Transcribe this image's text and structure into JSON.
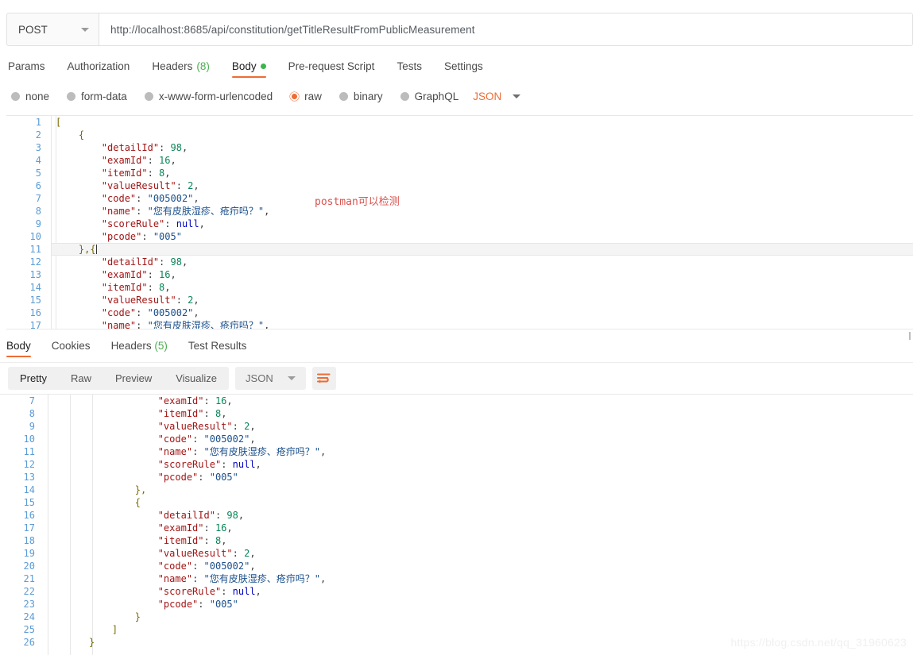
{
  "request": {
    "method": "POST",
    "url": "http://localhost:8685/api/constitution/getTitleResultFromPublicMeasurement",
    "tabs": [
      {
        "label": "Params",
        "count": "",
        "dot": false,
        "active": false
      },
      {
        "label": "Authorization",
        "count": "",
        "dot": false,
        "active": false
      },
      {
        "label": "Headers",
        "count": "(8)",
        "dot": false,
        "active": false
      },
      {
        "label": "Body",
        "count": "",
        "dot": true,
        "active": true
      },
      {
        "label": "Pre-request Script",
        "count": "",
        "dot": false,
        "active": false
      },
      {
        "label": "Tests",
        "count": "",
        "dot": false,
        "active": false
      },
      {
        "label": "Settings",
        "count": "",
        "dot": false,
        "active": false
      }
    ],
    "body_types": [
      {
        "label": "none",
        "selected": false
      },
      {
        "label": "form-data",
        "selected": false
      },
      {
        "label": "x-www-form-urlencoded",
        "selected": false
      },
      {
        "label": "raw",
        "selected": true
      },
      {
        "label": "binary",
        "selected": false
      },
      {
        "label": "GraphQL",
        "selected": false
      }
    ],
    "raw_format": "JSON",
    "body_lines": [
      {
        "n": 1,
        "segments": [
          {
            "t": "[",
            "c": "br"
          }
        ]
      },
      {
        "n": 2,
        "segments": [
          {
            "t": "    {",
            "c": "br"
          }
        ]
      },
      {
        "n": 3,
        "segments": [
          {
            "t": "        ",
            "c": "p"
          },
          {
            "t": "\"detailId\"",
            "c": "k"
          },
          {
            "t": ": ",
            "c": "p"
          },
          {
            "t": "98",
            "c": "n"
          },
          {
            "t": ",",
            "c": "p"
          }
        ]
      },
      {
        "n": 4,
        "segments": [
          {
            "t": "        ",
            "c": "p"
          },
          {
            "t": "\"examId\"",
            "c": "k"
          },
          {
            "t": ": ",
            "c": "p"
          },
          {
            "t": "16",
            "c": "n"
          },
          {
            "t": ",",
            "c": "p"
          }
        ]
      },
      {
        "n": 5,
        "segments": [
          {
            "t": "        ",
            "c": "p"
          },
          {
            "t": "\"itemId\"",
            "c": "k"
          },
          {
            "t": ": ",
            "c": "p"
          },
          {
            "t": "8",
            "c": "n"
          },
          {
            "t": ",",
            "c": "p"
          }
        ]
      },
      {
        "n": 6,
        "segments": [
          {
            "t": "        ",
            "c": "p"
          },
          {
            "t": "\"valueResult\"",
            "c": "k"
          },
          {
            "t": ": ",
            "c": "p"
          },
          {
            "t": "2",
            "c": "n"
          },
          {
            "t": ",",
            "c": "p"
          }
        ]
      },
      {
        "n": 7,
        "segments": [
          {
            "t": "        ",
            "c": "p"
          },
          {
            "t": "\"code\"",
            "c": "k"
          },
          {
            "t": ": ",
            "c": "p"
          },
          {
            "t": "\"005002\"",
            "c": "s"
          },
          {
            "t": ",",
            "c": "p"
          }
        ]
      },
      {
        "n": 8,
        "segments": [
          {
            "t": "        ",
            "c": "p"
          },
          {
            "t": "\"name\"",
            "c": "k"
          },
          {
            "t": ": ",
            "c": "p"
          },
          {
            "t": "\"您有皮肤湿疹、疮疖吗？\"",
            "c": "s"
          },
          {
            "t": ",",
            "c": "p"
          }
        ]
      },
      {
        "n": 9,
        "segments": [
          {
            "t": "        ",
            "c": "p"
          },
          {
            "t": "\"scoreRule\"",
            "c": "k"
          },
          {
            "t": ": ",
            "c": "p"
          },
          {
            "t": "null",
            "c": "nl"
          },
          {
            "t": ",",
            "c": "p"
          }
        ]
      },
      {
        "n": 10,
        "segments": [
          {
            "t": "        ",
            "c": "p"
          },
          {
            "t": "\"pcode\"",
            "c": "k"
          },
          {
            "t": ": ",
            "c": "p"
          },
          {
            "t": "\"005\"",
            "c": "s"
          }
        ]
      },
      {
        "n": 11,
        "segments": [
          {
            "t": "    },{",
            "c": "br"
          }
        ],
        "active": true,
        "cursor": true
      },
      {
        "n": 12,
        "segments": [
          {
            "t": "        ",
            "c": "p"
          },
          {
            "t": "\"detailId\"",
            "c": "k"
          },
          {
            "t": ": ",
            "c": "p"
          },
          {
            "t": "98",
            "c": "n"
          },
          {
            "t": ",",
            "c": "p"
          }
        ]
      },
      {
        "n": 13,
        "segments": [
          {
            "t": "        ",
            "c": "p"
          },
          {
            "t": "\"examId\"",
            "c": "k"
          },
          {
            "t": ": ",
            "c": "p"
          },
          {
            "t": "16",
            "c": "n"
          },
          {
            "t": ",",
            "c": "p"
          }
        ]
      },
      {
        "n": 14,
        "segments": [
          {
            "t": "        ",
            "c": "p"
          },
          {
            "t": "\"itemId\"",
            "c": "k"
          },
          {
            "t": ": ",
            "c": "p"
          },
          {
            "t": "8",
            "c": "n"
          },
          {
            "t": ",",
            "c": "p"
          }
        ]
      },
      {
        "n": 15,
        "segments": [
          {
            "t": "        ",
            "c": "p"
          },
          {
            "t": "\"valueResult\"",
            "c": "k"
          },
          {
            "t": ": ",
            "c": "p"
          },
          {
            "t": "2",
            "c": "n"
          },
          {
            "t": ",",
            "c": "p"
          }
        ]
      },
      {
        "n": 16,
        "segments": [
          {
            "t": "        ",
            "c": "p"
          },
          {
            "t": "\"code\"",
            "c": "k"
          },
          {
            "t": ": ",
            "c": "p"
          },
          {
            "t": "\"005002\"",
            "c": "s"
          },
          {
            "t": ",",
            "c": "p"
          }
        ]
      },
      {
        "n": 17,
        "segments": [
          {
            "t": "        ",
            "c": "p"
          },
          {
            "t": "\"name\"",
            "c": "k"
          },
          {
            "t": ": ",
            "c": "p"
          },
          {
            "t": "\"您有皮肤湿疹、疮疖吗？\"",
            "c": "s"
          },
          {
            "t": ",",
            "c": "p"
          }
        ]
      }
    ]
  },
  "annotation": "postman可以检测",
  "response": {
    "tabs": [
      {
        "label": "Body",
        "count": "",
        "active": true
      },
      {
        "label": "Cookies",
        "count": "",
        "active": false
      },
      {
        "label": "Headers",
        "count": "(5)",
        "active": false
      },
      {
        "label": "Test Results",
        "count": "",
        "active": false
      }
    ],
    "view_modes": [
      {
        "label": "Pretty",
        "active": true
      },
      {
        "label": "Raw",
        "active": false
      },
      {
        "label": "Preview",
        "active": false
      },
      {
        "label": "Visualize",
        "active": false
      }
    ],
    "format": "JSON",
    "wrap_icon": "wrap-lines-icon",
    "body_lines": [
      {
        "n": 7,
        "segments": [
          {
            "t": "            ",
            "c": "p"
          },
          {
            "t": "\"examId\"",
            "c": "k"
          },
          {
            "t": ": ",
            "c": "p"
          },
          {
            "t": "16",
            "c": "n"
          },
          {
            "t": ",",
            "c": "p"
          }
        ]
      },
      {
        "n": 8,
        "segments": [
          {
            "t": "            ",
            "c": "p"
          },
          {
            "t": "\"itemId\"",
            "c": "k"
          },
          {
            "t": ": ",
            "c": "p"
          },
          {
            "t": "8",
            "c": "n"
          },
          {
            "t": ",",
            "c": "p"
          }
        ]
      },
      {
        "n": 9,
        "segments": [
          {
            "t": "            ",
            "c": "p"
          },
          {
            "t": "\"valueResult\"",
            "c": "k"
          },
          {
            "t": ": ",
            "c": "p"
          },
          {
            "t": "2",
            "c": "n"
          },
          {
            "t": ",",
            "c": "p"
          }
        ]
      },
      {
        "n": 10,
        "segments": [
          {
            "t": "            ",
            "c": "p"
          },
          {
            "t": "\"code\"",
            "c": "k"
          },
          {
            "t": ": ",
            "c": "p"
          },
          {
            "t": "\"005002\"",
            "c": "s"
          },
          {
            "t": ",",
            "c": "p"
          }
        ]
      },
      {
        "n": 11,
        "segments": [
          {
            "t": "            ",
            "c": "p"
          },
          {
            "t": "\"name\"",
            "c": "k"
          },
          {
            "t": ": ",
            "c": "p"
          },
          {
            "t": "\"您有皮肤湿疹、疮疖吗？\"",
            "c": "s"
          },
          {
            "t": ",",
            "c": "p"
          }
        ]
      },
      {
        "n": 12,
        "segments": [
          {
            "t": "            ",
            "c": "p"
          },
          {
            "t": "\"scoreRule\"",
            "c": "k"
          },
          {
            "t": ": ",
            "c": "p"
          },
          {
            "t": "null",
            "c": "nl"
          },
          {
            "t": ",",
            "c": "p"
          }
        ]
      },
      {
        "n": 13,
        "segments": [
          {
            "t": "            ",
            "c": "p"
          },
          {
            "t": "\"pcode\"",
            "c": "k"
          },
          {
            "t": ": ",
            "c": "p"
          },
          {
            "t": "\"005\"",
            "c": "s"
          }
        ]
      },
      {
        "n": 14,
        "segments": [
          {
            "t": "        },",
            "c": "br"
          }
        ]
      },
      {
        "n": 15,
        "segments": [
          {
            "t": "        {",
            "c": "br"
          }
        ]
      },
      {
        "n": 16,
        "segments": [
          {
            "t": "            ",
            "c": "p"
          },
          {
            "t": "\"detailId\"",
            "c": "k"
          },
          {
            "t": ": ",
            "c": "p"
          },
          {
            "t": "98",
            "c": "n"
          },
          {
            "t": ",",
            "c": "p"
          }
        ]
      },
      {
        "n": 17,
        "segments": [
          {
            "t": "            ",
            "c": "p"
          },
          {
            "t": "\"examId\"",
            "c": "k"
          },
          {
            "t": ": ",
            "c": "p"
          },
          {
            "t": "16",
            "c": "n"
          },
          {
            "t": ",",
            "c": "p"
          }
        ]
      },
      {
        "n": 18,
        "segments": [
          {
            "t": "            ",
            "c": "p"
          },
          {
            "t": "\"itemId\"",
            "c": "k"
          },
          {
            "t": ": ",
            "c": "p"
          },
          {
            "t": "8",
            "c": "n"
          },
          {
            "t": ",",
            "c": "p"
          }
        ]
      },
      {
        "n": 19,
        "segments": [
          {
            "t": "            ",
            "c": "p"
          },
          {
            "t": "\"valueResult\"",
            "c": "k"
          },
          {
            "t": ": ",
            "c": "p"
          },
          {
            "t": "2",
            "c": "n"
          },
          {
            "t": ",",
            "c": "p"
          }
        ]
      },
      {
        "n": 20,
        "segments": [
          {
            "t": "            ",
            "c": "p"
          },
          {
            "t": "\"code\"",
            "c": "k"
          },
          {
            "t": ": ",
            "c": "p"
          },
          {
            "t": "\"005002\"",
            "c": "s"
          },
          {
            "t": ",",
            "c": "p"
          }
        ]
      },
      {
        "n": 21,
        "segments": [
          {
            "t": "            ",
            "c": "p"
          },
          {
            "t": "\"name\"",
            "c": "k"
          },
          {
            "t": ": ",
            "c": "p"
          },
          {
            "t": "\"您有皮肤湿疹、疮疖吗？\"",
            "c": "s"
          },
          {
            "t": ",",
            "c": "p"
          }
        ]
      },
      {
        "n": 22,
        "segments": [
          {
            "t": "            ",
            "c": "p"
          },
          {
            "t": "\"scoreRule\"",
            "c": "k"
          },
          {
            "t": ": ",
            "c": "p"
          },
          {
            "t": "null",
            "c": "nl"
          },
          {
            "t": ",",
            "c": "p"
          }
        ]
      },
      {
        "n": 23,
        "segments": [
          {
            "t": "            ",
            "c": "p"
          },
          {
            "t": "\"pcode\"",
            "c": "k"
          },
          {
            "t": ": ",
            "c": "p"
          },
          {
            "t": "\"005\"",
            "c": "s"
          }
        ]
      },
      {
        "n": 24,
        "segments": [
          {
            "t": "        }",
            "c": "br"
          }
        ]
      },
      {
        "n": 25,
        "segments": [
          {
            "t": "    ]",
            "c": "br"
          }
        ]
      },
      {
        "n": 26,
        "segments": [
          {
            "t": "}",
            "c": "br"
          }
        ]
      }
    ]
  },
  "watermark": "https://blog.csdn.net/qq_31960623",
  "colors": {
    "accent": "#ef6b33",
    "green": "#4caf50",
    "annotation": "#d9534f",
    "line_number": "#5b9bd5"
  }
}
